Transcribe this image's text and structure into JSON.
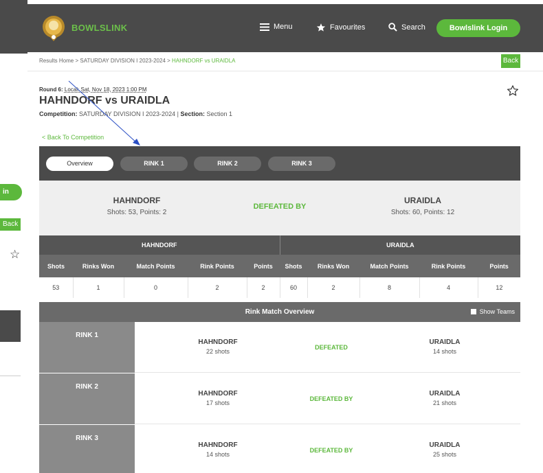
{
  "ghost": {
    "login_fragment": "in",
    "back_fragment": "Back"
  },
  "nav": {
    "logo_text": "BOWLSLINK",
    "menu_label": "Menu",
    "favourites_label": "Favourites",
    "search_label": "Search",
    "login_label": "Bowlslink Login"
  },
  "breadcrumb": {
    "items": [
      "Results Home",
      "SATURDAY DIVISION I 2023-2024",
      "HAHNDORF vs URAIDLA"
    ],
    "separator": ">"
  },
  "back_label": "Back",
  "match": {
    "round_label": "Round 6:",
    "round_date": "Local: Sat, Nov 18, 2023 1:00 PM",
    "title": "HAHNDORF vs URAIDLA",
    "competition_label": "Competition:",
    "competition_value": "SATURDAY DIVISION I 2023-2024",
    "divider": "|",
    "section_label": "Section:",
    "section_value": "Section 1",
    "back_to_competition": "< Back To Competition"
  },
  "tabs": [
    {
      "label": "Overview",
      "active": true
    },
    {
      "label": "RINK 1",
      "active": false
    },
    {
      "label": "RINK 2",
      "active": false
    },
    {
      "label": "RINK 3",
      "active": false
    }
  ],
  "summary": {
    "home": {
      "name": "HAHNDORF",
      "sub": "Shots: 53, Points: 2"
    },
    "result": "DEFEATED BY",
    "away": {
      "name": "URAIDLA",
      "sub": "Shots: 60, Points: 12"
    }
  },
  "stats": {
    "home_team": "HAHNDORF",
    "away_team": "URAIDLA",
    "columns": [
      "Shots",
      "Rinks Won",
      "Match Points",
      "Rink Points",
      "Points"
    ],
    "home_values": [
      "53",
      "1",
      "0",
      "2",
      "2"
    ],
    "away_values": [
      "60",
      "2",
      "8",
      "4",
      "12"
    ]
  },
  "rink_overview": {
    "title": "Rink Match Overview",
    "show_teams_label": "Show Teams",
    "rinks": [
      {
        "label": "RINK 1",
        "home": "HAHNDORF",
        "home_shots": "22 shots",
        "result": "DEFEATED",
        "away": "URAIDLA",
        "away_shots": "14 shots"
      },
      {
        "label": "RINK 2",
        "home": "HAHNDORF",
        "home_shots": "17 shots",
        "result": "DEFEATED BY",
        "away": "URAIDLA",
        "away_shots": "21 shots"
      },
      {
        "label": "RINK 3",
        "home": "HAHNDORF",
        "home_shots": "14 shots",
        "result": "DEFEATED BY",
        "away": "URAIDLA",
        "away_shots": "25 shots"
      }
    ]
  },
  "colors": {
    "brand_green": "#5cb83c",
    "nav_dark": "#4a4a4a",
    "header_gray": "#6a6a6a"
  }
}
